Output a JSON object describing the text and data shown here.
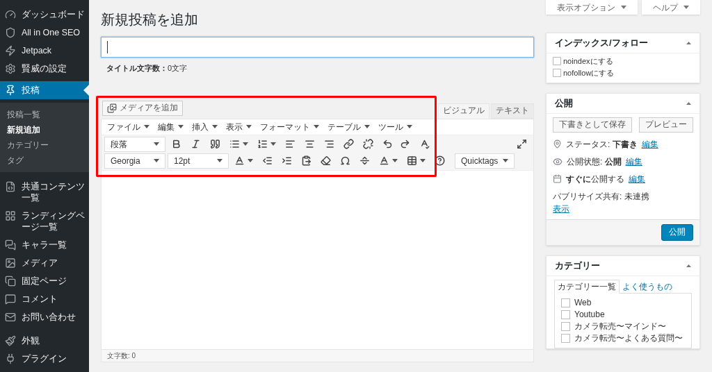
{
  "sidebar": {
    "items": [
      {
        "label": "ダッシュボード",
        "selected": false
      },
      {
        "label": "All in One SEO",
        "selected": false
      },
      {
        "label": "Jetpack",
        "selected": false
      },
      {
        "label": "賢威の設定",
        "selected": false
      },
      {
        "label": "投稿",
        "selected": true,
        "children": [
          {
            "label": "投稿一覧",
            "selected": false
          },
          {
            "label": "新規追加",
            "selected": true
          },
          {
            "label": "カテゴリー",
            "selected": false
          },
          {
            "label": "タグ",
            "selected": false
          }
        ]
      },
      {
        "label": "共通コンテンツ一覧",
        "selected": false
      },
      {
        "label": "ランディングページ一覧",
        "selected": false
      },
      {
        "label": "キャラ一覧",
        "selected": false
      },
      {
        "label": "メディア",
        "selected": false
      },
      {
        "label": "固定ページ",
        "selected": false
      },
      {
        "label": "コメント",
        "selected": false
      },
      {
        "label": "お問い合わせ",
        "selected": false
      },
      {
        "label": "外観",
        "selected": false
      },
      {
        "label": "プラグイン",
        "selected": false
      }
    ]
  },
  "screen_buttons": [
    "表示オプション",
    "ヘルプ"
  ],
  "page_title": "新規投稿を追加",
  "title_count": {
    "label": "タイトル文字数：",
    "value": "0文字"
  },
  "editor": {
    "media_button": "メディアを追加",
    "tabs": [
      {
        "label": "ビジュアル",
        "selected": true
      },
      {
        "label": "テキスト",
        "selected": false
      }
    ],
    "menus": [
      "ファイル",
      "編集",
      "挿入",
      "表示",
      "フォーマット",
      "テーブル",
      "ツール"
    ],
    "format_select": "段落",
    "font_select": "Georgia",
    "size_select": "12pt",
    "quicktags_select": "Quicktags",
    "word_count": "文字数: 0"
  },
  "index_box": {
    "title": "インデックス/フォロー",
    "options": [
      {
        "label": "noindexにする",
        "checked": false
      },
      {
        "label": "nofollowにする",
        "checked": false
      }
    ]
  },
  "publish_box": {
    "title": "公開",
    "save_draft": "下書きとして保存",
    "preview": "プレビュー",
    "rows": [
      {
        "kind": "status",
        "text": "ステータス: **下書き**",
        "link": "編集"
      },
      {
        "kind": "visibility",
        "text": "公開状態: **公開**",
        "link": "編集"
      },
      {
        "kind": "schedule",
        "text": "**すぐに**公開する",
        "link": "編集"
      }
    ],
    "publicize": "パブリサイズ共有: 未連携",
    "publicize_link": "表示",
    "publish_button": "公開"
  },
  "category_box": {
    "title": "カテゴリー",
    "tabs": [
      {
        "label": "カテゴリー一覧",
        "selected": true
      },
      {
        "label": "よく使うもの",
        "selected": false
      }
    ],
    "items": [
      {
        "label": "Web",
        "checked": false
      },
      {
        "label": "Youtube",
        "checked": false
      },
      {
        "label": "カメラ転売〜マインド〜",
        "checked": false
      },
      {
        "label": "カメラ転売〜よくある質問〜",
        "checked": false
      }
    ]
  }
}
